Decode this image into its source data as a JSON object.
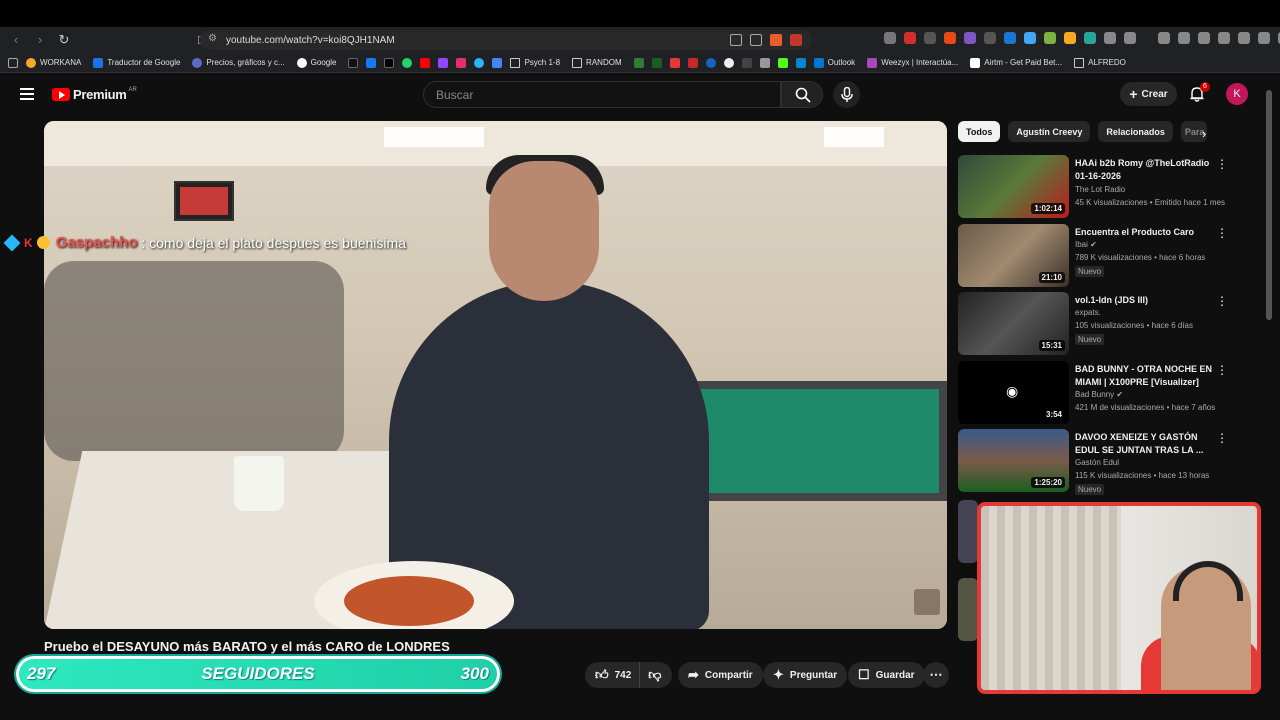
{
  "browser": {
    "url": "youtube.com/watch?v=koi8QJH1NAM",
    "bookmarks": [
      "WORKANA",
      "Traductor de Google",
      "Precios, gráficos y c...",
      "Google",
      "Psych 1-8",
      "RANDOM",
      "Outlook",
      "Weezyx | Interactúa...",
      "Airtm - Get Paid Bet...",
      "ALFREDO"
    ]
  },
  "header": {
    "logo_text": "Premium",
    "logo_region": "AR",
    "search_placeholder": "Buscar",
    "create_label": "Crear",
    "notif_count": "6",
    "avatar_letter": "K"
  },
  "chat_overlay": {
    "user": "Gaspachho",
    "message": ": como deja el plato despues es buenisima"
  },
  "video": {
    "title": "Pruebo el DESAYUNO más BARATO y el más CARO de LONDRES",
    "likes": "742",
    "share_label": "Compartir",
    "ask_label": "Preguntar",
    "save_label": "Guardar"
  },
  "followers_bar": {
    "current": "297",
    "label": "SEGUIDORES",
    "goal": "300"
  },
  "chips": [
    "Todos",
    "Agustín Creevy",
    "Relacionados",
    "Para"
  ],
  "recommendations": [
    {
      "title": "HAAi b2b Romy @TheLotRadio 01-16-2026",
      "channel": "The Lot Radio",
      "meta": "45 K visualizaciones • Emitido hace 1 mes",
      "duration": "1:02:14",
      "badge": "",
      "thumb_color": "#2e4a3a"
    },
    {
      "title": "Encuentra el Producto Caro",
      "channel": "Ibai",
      "meta": "789 K visualizaciones • hace 6 horas",
      "duration": "21:10",
      "badge": "Nuevo",
      "thumb_color": "#6a5a48"
    },
    {
      "title": "vol.1-ldn (JDS III)",
      "channel": "expats.",
      "meta": "105 visualizaciones • hace 6 días",
      "duration": "15:31",
      "badge": "Nuevo",
      "thumb_color": "#333333"
    },
    {
      "title": "BAD BUNNY - OTRA NOCHE EN MIAMI | X100PRE [Visualizer]",
      "channel": "Bad Bunny",
      "meta": "421 M de visualizaciones • hace 7 años",
      "duration": "3:54",
      "badge": "",
      "thumb_color": "#000000"
    },
    {
      "title": "DAVOO XENEIZE Y GASTÓN EDUL SE JUNTAN TRAS LA ...",
      "channel": "Gastón Edul",
      "meta": "115 K visualizaciones • hace 13 horas",
      "duration": "1:25:20",
      "badge": "Nuevo",
      "thumb_color": "#3a5a8a"
    }
  ]
}
